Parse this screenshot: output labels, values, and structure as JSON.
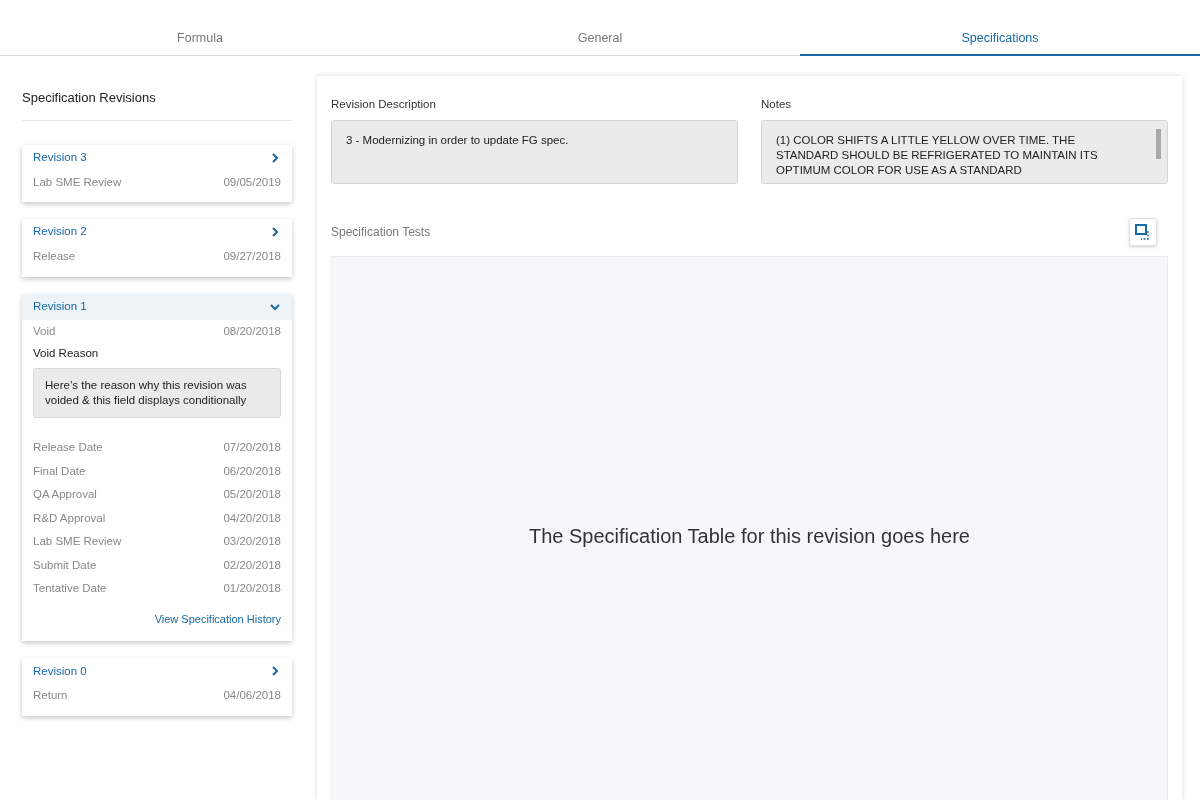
{
  "tabs": [
    {
      "label": "Formula",
      "selected": false
    },
    {
      "label": "General",
      "selected": false
    },
    {
      "label": "Specifications",
      "selected": true
    }
  ],
  "revisions_panel": {
    "title": "Specification Revisions",
    "revisions": [
      {
        "title": "Revision 3",
        "expanded": false,
        "status": "Lab SME Review",
        "date": "09/05/2019"
      },
      {
        "title": "Revision 2",
        "expanded": false,
        "status": "Release",
        "date": "09/27/2018"
      },
      {
        "title": "Revision 1",
        "expanded": true,
        "status": "Void",
        "date": "08/20/2018",
        "void_reason_label": "Void Reason",
        "void_reason": "Here’s the reason why this revision was voided & this field displays conditionally",
        "history": [
          {
            "label": "Release Date",
            "date": "07/20/2018"
          },
          {
            "label": "Final Date",
            "date": "06/20/2018"
          },
          {
            "label": "QA Approval",
            "date": "05/20/2018"
          },
          {
            "label": "R&D Approval",
            "date": "04/20/2018"
          },
          {
            "label": "Lab SME Review",
            "date": "03/20/2018"
          },
          {
            "label": "Submit Date",
            "date": "02/20/2018"
          },
          {
            "label": "Tentative Date",
            "date": "01/20/2018"
          }
        ],
        "history_link": "View Specification History"
      },
      {
        "title": "Revision 0",
        "expanded": false,
        "status": "Return",
        "date": "04/06/2018"
      }
    ]
  },
  "detail": {
    "description_label": "Revision Description",
    "description": "3 - Modernizing in order to update FG spec.",
    "notes_label": "Notes",
    "notes": "(1) COLOR SHIFTS A LITTLE YELLOW OVER TIME. THE STANDARD SHOULD BE REFRIGERATED TO MAINTAIN ITS OPTIMUM COLOR FOR USE AS A STANDARD",
    "tests_label": "Specification Tests",
    "table_placeholder": "The Specification Table for this revision goes here"
  }
}
